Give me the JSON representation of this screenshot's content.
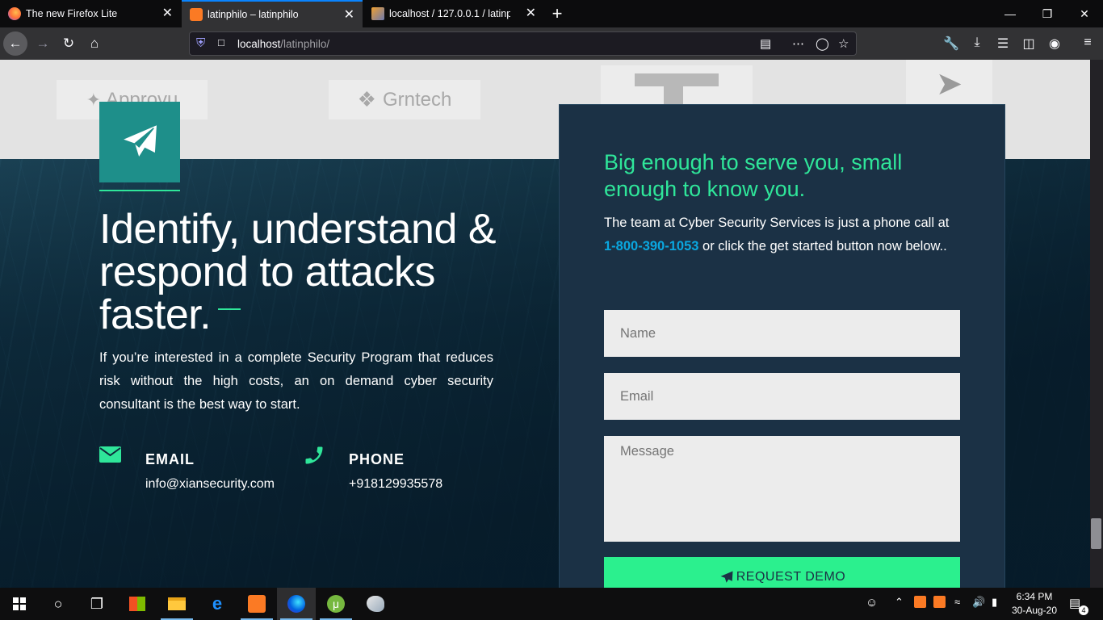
{
  "browser": {
    "tabs": [
      {
        "title": "The new Firefox Lite",
        "close": "✕"
      },
      {
        "title": "latinphilo – latinphilo",
        "close": "✕"
      },
      {
        "title": "localhost / 127.0.0.1 / latinphilo",
        "close": "✕"
      }
    ],
    "new_tab": "+",
    "url_host": "localhost",
    "url_path": "/latinphilo/"
  },
  "logos": [
    "Approvu",
    "Grntech"
  ],
  "hero": {
    "heading": "Identify, understand & respond to attacks faster.",
    "intro": "If you’re interested in a complete Security Program that reduces risk without the high costs, an on demand cyber security consultant is the best way to start.",
    "email_label": "EMAIL",
    "email_value": "info@xiansecurity.com",
    "phone_label": "PHONE",
    "phone_value": "+918129935578"
  },
  "card": {
    "title": "Big enough to serve you, small enough to know you.",
    "text_before": "The team at Cyber Security Services is just a phone call at",
    "phone": "1-800-390-1053",
    "text_after": "or click the get started button now below..",
    "name_placeholder": "Name",
    "email_placeholder": "Email",
    "message_placeholder": "Message",
    "submit_label": "REQUEST DEMO"
  },
  "taskbar": {
    "time": "6:34 PM",
    "date": "30-Aug-20",
    "notifications": "4"
  },
  "colors": {
    "accent": "#2fe69a",
    "card_bg": "#1b3145",
    "link": "#0aa7e0",
    "icon_box": "#1e8f8a"
  }
}
